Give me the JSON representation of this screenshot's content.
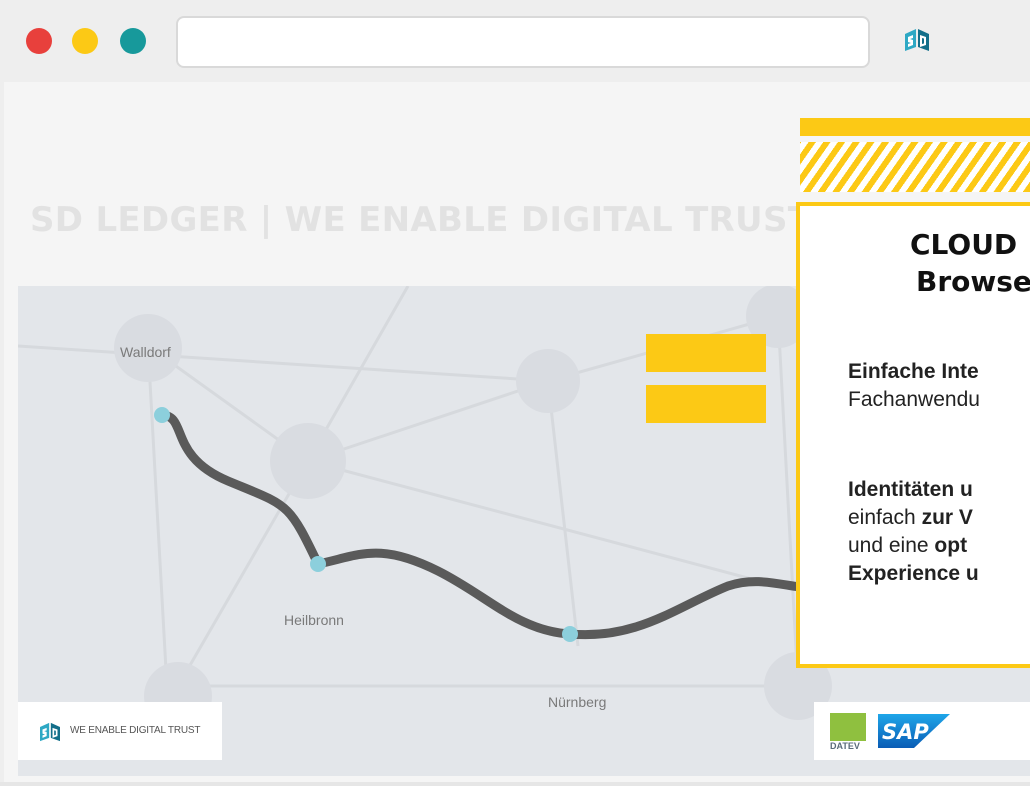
{
  "colors": {
    "traffic_red": "#e8403c",
    "traffic_yellow": "#fcc915",
    "traffic_green": "#17999b",
    "accent_yellow": "#fcc915",
    "brand_teal": "#1ba0b0",
    "route": "#5a5a5a",
    "route_node": "#8ccfdc"
  },
  "browser": {
    "url": "",
    "logo_icon": "sd-ledger-logo-icon"
  },
  "page": {
    "hero_title": "SD LEDGER | WE ENABLE DIGITAL TRUST"
  },
  "map": {
    "cities": {
      "walldorf": "Walldorf",
      "heilbronn": "Heilbronn",
      "nuernberg": "Nürnberg"
    }
  },
  "footer": {
    "tagline": "WE ENABLE DIGITAL TRUST",
    "datev_label": "DATEV",
    "sap_label": "SAP"
  },
  "card": {
    "title_line1": "CLOUD",
    "title_line2": "Browse",
    "p1_bold": "Einfache Inte",
    "p1_text": "Fachanwendu",
    "p2_bold": "Identitäten u",
    "p2_line2_text": "einfach ",
    "p2_line2_bold": "zur V",
    "p2_line3_text": "und eine ",
    "p2_line3_bold": "opt",
    "p2_line4_bold": "Experience u"
  }
}
